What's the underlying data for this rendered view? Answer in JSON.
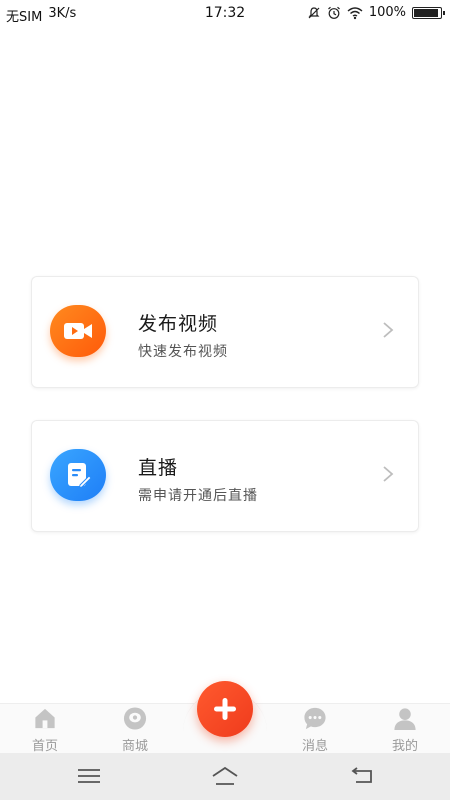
{
  "status_bar": {
    "carrier": "无SIM",
    "speed": "3K/s",
    "time": "17:32",
    "battery": "100%",
    "battery_level": 1.0
  },
  "options": [
    {
      "title": "发布视频",
      "subtitle": "快速发布视频",
      "icon": "video-camera-icon",
      "color": "#ff6d12"
    },
    {
      "title": "直播",
      "subtitle": "需申请开通后直播",
      "icon": "edit-document-icon",
      "color": "#2a8cf8"
    }
  ],
  "tabbar": {
    "home": "首页",
    "mall": "商城",
    "messages": "消息",
    "me": "我的",
    "plus_icon": "plus-icon",
    "accent": "#f2461f"
  },
  "navbar": {
    "menu_icon": "menu-icon",
    "home_icon": "home-outline-icon",
    "back_icon": "back-icon"
  }
}
